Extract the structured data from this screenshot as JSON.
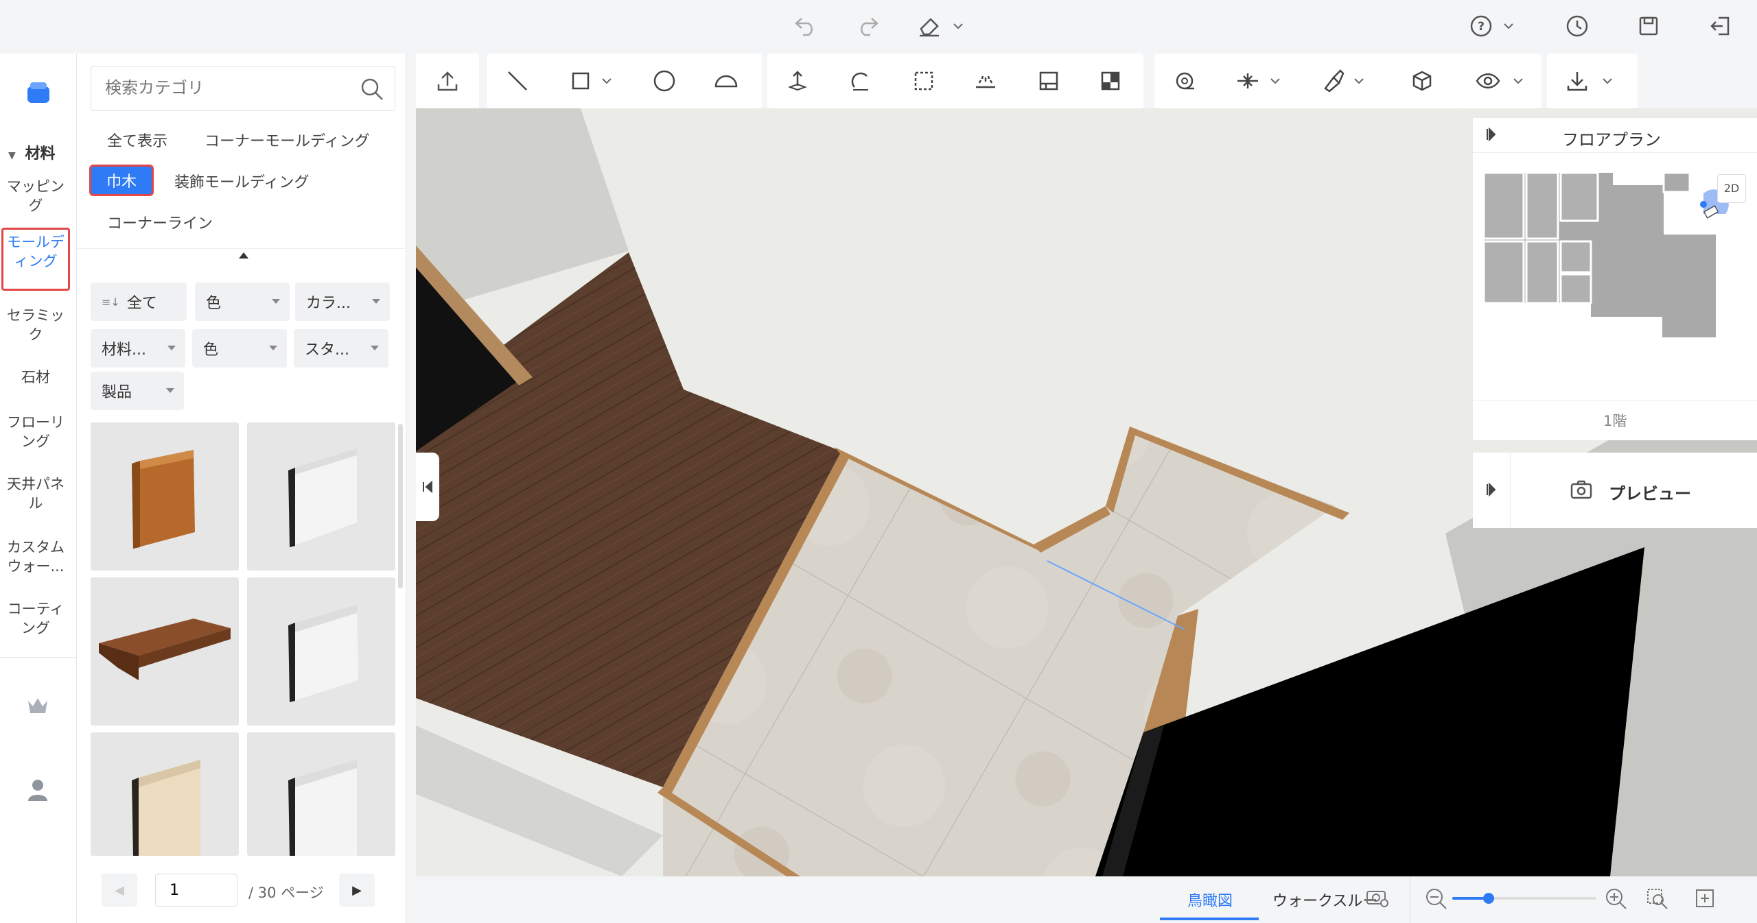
{
  "rail": {
    "section_title": "材料",
    "items": [
      {
        "label": "マッピング"
      },
      {
        "label": "モールディング"
      },
      {
        "label": "セラミック"
      },
      {
        "label": "石材"
      },
      {
        "label": "フローリング"
      },
      {
        "label": "天井パネル"
      },
      {
        "label": "カスタムウォー..."
      },
      {
        "label": "コーティング"
      }
    ]
  },
  "panel": {
    "search_placeholder": "検索カテゴリ",
    "categories": [
      "全て表示",
      "コーナーモールディング",
      "巾木",
      "装飾モールディング",
      "コーナーライン"
    ],
    "selected_category": "巾木",
    "filters_row1": [
      "全て",
      "色",
      "カラ..."
    ],
    "filters_row2": [
      "材料...",
      "色",
      "スタ..."
    ],
    "filters_row3": [
      "製品"
    ],
    "pager": {
      "current": "1",
      "total_label": "/ 30 ページ"
    }
  },
  "floorplan": {
    "title": "フロアプラン",
    "badge": "2D",
    "level": "1階"
  },
  "preview": {
    "label": "プレビュー"
  },
  "bottom": {
    "tabs": [
      "鳥瞰図",
      "ウォークスルー"
    ],
    "active_tab": "鳥瞰図",
    "zoom_fraction": 0.25
  },
  "colors": {
    "accent": "#2f7bf6",
    "highlight_border": "#e34646",
    "dark_wood": "#5b3e2d",
    "tile": "#d9d4cc",
    "trim_wood": "#b78755"
  }
}
